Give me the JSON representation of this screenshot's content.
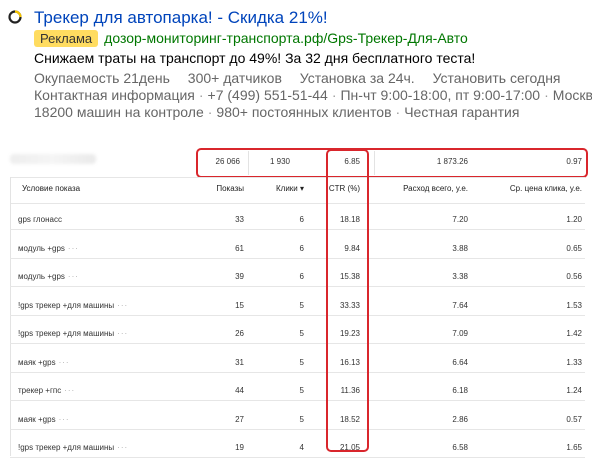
{
  "ad": {
    "title": "Трекер для автопарка! - Скидка 21%!",
    "badge": "Реклама",
    "url": "дозор-мониторинг-транспорта.рф/Gps-Трекер-Для-Авто",
    "text": "Снижаем траты на транспорт до 49%! За 32 дня бесплатного теста!",
    "links": [
      "Окупаемость 21день",
      "300+ датчиков",
      "Установка за 24ч.",
      "Установить сегодня"
    ],
    "contacts": [
      "Контактная информация",
      "+7 (499) 551-51-44",
      "Пн-чт 9:00-18:00, пт 9:00-17:00",
      "Москва"
    ],
    "extra": [
      "18200 машин на контроле",
      "980+ постоянных клиентов",
      "Честная гарантия"
    ],
    "separator": "·",
    "colors": {
      "title": "#0044bb",
      "badge": "#ffdc60",
      "url": "#007700",
      "highlight": "#d9262c"
    }
  },
  "stats": {
    "totals": {
      "impressions": "26 066",
      "clicks": "1 930",
      "ctr": "6.85",
      "cost": "1 873.26",
      "cpc": "0.97"
    },
    "headers": {
      "condition": "Условие показа",
      "impressions": "Показы",
      "clicks": "Клики ▾",
      "ctr": "CTR (%)",
      "cost": "Расход всего, у.е.",
      "cpc": "Ср. цена клика, у.е."
    },
    "more_marker": "···",
    "rows": [
      {
        "condition": "gps глонасс",
        "more": false,
        "impressions": "33",
        "clicks": "6",
        "ctr": "18.18",
        "cost": "7.20",
        "cpc": "1.20"
      },
      {
        "condition": "модуль +gps",
        "more": true,
        "impressions": "61",
        "clicks": "6",
        "ctr": "9.84",
        "cost": "3.88",
        "cpc": "0.65"
      },
      {
        "condition": "модуль +gps",
        "more": true,
        "impressions": "39",
        "clicks": "6",
        "ctr": "15.38",
        "cost": "3.38",
        "cpc": "0.56"
      },
      {
        "condition": "!gps трекер +для машины",
        "more": true,
        "impressions": "15",
        "clicks": "5",
        "ctr": "33.33",
        "cost": "7.64",
        "cpc": "1.53"
      },
      {
        "condition": "!gps трекер +для машины",
        "more": true,
        "impressions": "26",
        "clicks": "5",
        "ctr": "19.23",
        "cost": "7.09",
        "cpc": "1.42"
      },
      {
        "condition": "маяк +gps",
        "more": true,
        "impressions": "31",
        "clicks": "5",
        "ctr": "16.13",
        "cost": "6.64",
        "cpc": "1.33"
      },
      {
        "condition": "трекер +гпс",
        "more": true,
        "impressions": "44",
        "clicks": "5",
        "ctr": "11.36",
        "cost": "6.18",
        "cpc": "1.24"
      },
      {
        "condition": "маяк +gps",
        "more": true,
        "impressions": "27",
        "clicks": "5",
        "ctr": "18.52",
        "cost": "2.86",
        "cpc": "0.57"
      },
      {
        "condition": "!gps трекер +для машины",
        "more": true,
        "impressions": "19",
        "clicks": "4",
        "ctr": "21.05",
        "cost": "6.58",
        "cpc": "1.65"
      }
    ]
  }
}
